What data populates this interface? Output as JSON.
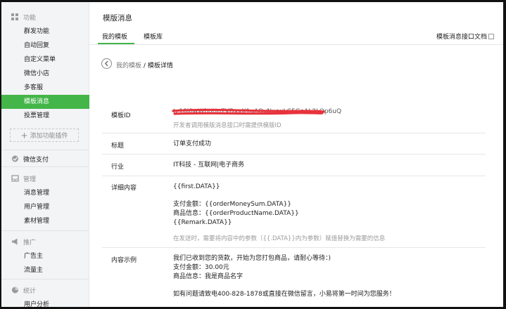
{
  "sidebar": {
    "sections": [
      {
        "title": "功能",
        "icon": "grid-icon"
      },
      {
        "title": "微信支付",
        "icon": "wallet-icon"
      },
      {
        "title": "管理",
        "icon": "inbox-icon"
      },
      {
        "title": "推广",
        "icon": "megaphone-icon"
      },
      {
        "title": "统计",
        "icon": "pie-chart-icon"
      }
    ],
    "function_items": [
      "群发功能",
      "自动回复",
      "自定义菜单",
      "微信小店",
      "多客服",
      "模板消息",
      "投票管理"
    ],
    "add_plugin": "添加功能插件",
    "manage_items": [
      "消息管理",
      "用户管理",
      "素材管理"
    ],
    "promo_items": [
      "广告主",
      "流量主"
    ],
    "stats_items": [
      "用户分析"
    ]
  },
  "main": {
    "title": "模版消息",
    "tabs": [
      "我的模板",
      "模板库"
    ],
    "doc_link": "模板消息接口文档",
    "breadcrumb": {
      "parent": "我的模板",
      "separator": "/",
      "current": "模板详情"
    },
    "fields": {
      "id_label": "模板ID",
      "id_value": "tz10j0wWbuUp7VDxvX1uAQvNuaxLC5GaAL2LOp6uQ",
      "id_hint": "开发者调用模版消息接口时需提供模版ID",
      "title_label": "标题",
      "title_value": "订单支付成功",
      "industry_label": "行业",
      "industry_value": "IT科技 - 互联网|电子商务",
      "detail_label": "详细内容",
      "detail_lines": [
        "{{first.DATA}}",
        "",
        "支付金额：{{orderMoneySum.DATA}}",
        "商品信息：{{orderProductName.DATA}}",
        "{{Remark.DATA}}"
      ],
      "detail_hint": "在发送时，需要将内容中的参数（{{.DATA}}内为参数）赋值替换为需要的信息",
      "example_label": "内容示例",
      "example_lines": [
        "我们已收到您的货款，开始为您打包商品，请耐心等待：)",
        "支付金额：30.00元",
        "商品信息：我是商品名字",
        "",
        "如有问题请致电400-828-1878或直接在微信留言，小易将第一时间为您服务！"
      ]
    }
  },
  "colors": {
    "accent": "#44b549",
    "redact": "#e8323c"
  }
}
